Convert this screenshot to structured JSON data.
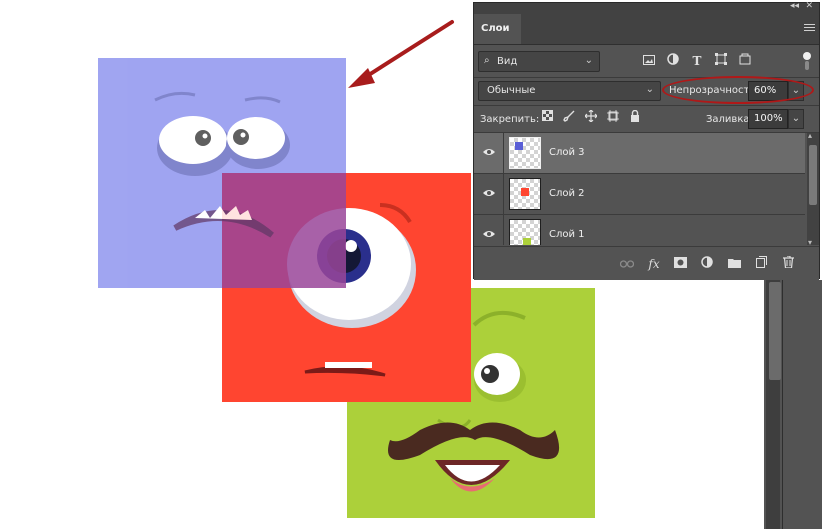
{
  "canvas": {
    "colors": {
      "blue_square": "#8f95ef",
      "red_square": "#ff4530",
      "green_square": "#acd03a",
      "overlap_purple": "#99469a",
      "arrow": "#a81c1c"
    }
  },
  "panel": {
    "title": "Слои",
    "kind_filter": {
      "value": "Вид",
      "icon": "search-icon"
    },
    "filter_icons": [
      "image-filter-icon",
      "adjustment-filter-icon",
      "type-filter-icon",
      "shape-filter-icon",
      "smart-object-filter-icon"
    ],
    "blend_mode": {
      "value": "Обычные"
    },
    "opacity": {
      "label": "Непрозрачность:",
      "value": "60%"
    },
    "lock": {
      "label": "Закрепить:",
      "icons": [
        "lock-transparency-icon",
        "lock-image-icon",
        "lock-position-icon",
        "lock-artboard-icon",
        "lock-all-icon"
      ]
    },
    "fill": {
      "label": "Заливка:",
      "value": "100%"
    },
    "layers": [
      {
        "name": "Слой 3",
        "selected": true,
        "thumb_color": "#5a5fd6"
      },
      {
        "name": "Слой 2",
        "selected": false,
        "thumb_color": "#ff4530"
      },
      {
        "name": "Слой 1",
        "selected": false,
        "thumb_color": "#acd03a"
      }
    ],
    "bottom_icons": [
      "link-layers-icon",
      "fx-icon",
      "layer-mask-icon",
      "adjustment-layer-icon",
      "new-group-icon",
      "new-layer-icon",
      "delete-layer-icon"
    ],
    "fx_label": "fx"
  }
}
